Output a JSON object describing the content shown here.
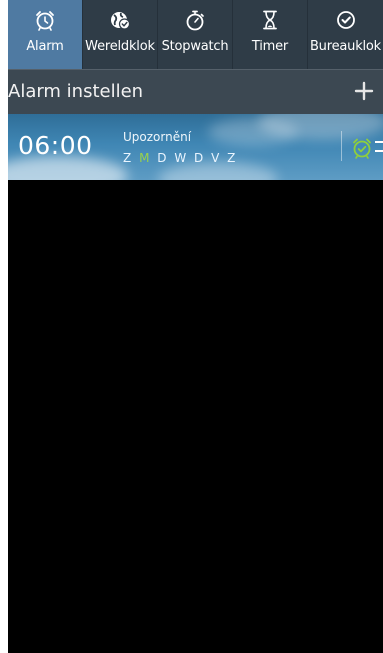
{
  "tabs": [
    {
      "label": "Alarm",
      "icon": "alarm-clock-icon",
      "active": true
    },
    {
      "label": "Wereldklok",
      "icon": "world-clock-icon",
      "active": false
    },
    {
      "label": "Stopwatch",
      "icon": "stopwatch-icon",
      "active": false
    },
    {
      "label": "Timer",
      "icon": "hourglass-icon",
      "active": false
    },
    {
      "label": "Bureauklok",
      "icon": "desk-clock-icon",
      "active": false
    }
  ],
  "header": {
    "title": "Alarm instellen",
    "add_icon": "plus-icon"
  },
  "alarms": [
    {
      "time": "06:00",
      "name": "Upozornění",
      "days": [
        "Z",
        "M",
        "D",
        "W",
        "D",
        "V",
        "Z"
      ],
      "active_days": [
        false,
        true,
        false,
        false,
        false,
        false,
        false
      ],
      "enabled": true,
      "toggle_icon": "alarm-on-icon"
    }
  ],
  "colors": {
    "tabbar_bg": "#2f3c47",
    "tab_active_bg": "#4f7aa2",
    "header_bg": "#3c4852",
    "active_day": "#9ad34a",
    "alarm_on_icon": "#8fcf3c"
  }
}
